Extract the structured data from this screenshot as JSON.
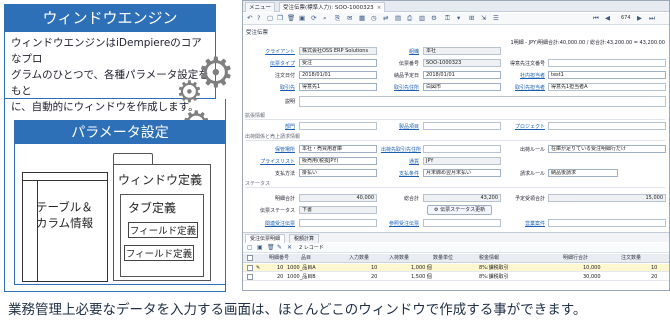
{
  "engine": {
    "title": "ウィンドウエンジン",
    "line1": "ウィンドウエンジンはiDempiereのコアなプロ",
    "line2": "グラムのひとつで、各種パラメータ設定をもと",
    "line3": "に、自動的にウィンドウを作成します。"
  },
  "params": {
    "title": "パラメータ設定",
    "table_line1": "テーブル＆",
    "table_line2": "カラム情報",
    "window_label": "ウィンドウ定義",
    "tab_label": "タブ定義",
    "field1": "フィールド定義",
    "field2": "フィールド定義"
  },
  "app": {
    "menu_tabs": [
      "メニュー",
      "受注伝票(標準入力): SOO-1000323"
    ],
    "record_counter": "674",
    "heading": "受注伝票",
    "summary": "1明細 - JPY)明細合計:40,000.00 / 総合計:43,200.00 = 43,200.00",
    "fields": {
      "client_label": "クライアント",
      "client_value": "株式会社OSS ERP Solutions",
      "org_label": "組織",
      "org_value": "本社",
      "doctype_label": "伝票タイプ",
      "doctype_value": "受注",
      "docno_label": "伝票番号",
      "docno_value": "SOO-1000323",
      "customer_order_label": "得意先注文番号",
      "customer_order_value": "",
      "orderdate_label": "注文日付",
      "orderdate_value": "2018/01/01",
      "promise_label": "納品予定日",
      "promise_value": "2018/01/01",
      "company_agent_label": "社内担当者",
      "company_agent_value": "test1",
      "bp_label": "取引先",
      "bp_value": "得意先1",
      "bp_addr_label": "取引先住所",
      "bp_addr_value": "白図市",
      "bp_contact_label": "取引先担当者",
      "bp_contact_value": "得意先1担当者A",
      "desc_label": "説明",
      "desc_value": ""
    },
    "sections": {
      "extension": "拡張情報",
      "shipping": "出荷関係と売上請求情報",
      "status": "ステータス"
    },
    "extension_fields": {
      "dept_label": "部門",
      "activity_label": "製品項目",
      "project_label": "プロジェクト"
    },
    "shipping_fields": {
      "warehouse_label": "保管場所",
      "warehouse_value": "本社・売買用倉庫",
      "ship_to_label": "出荷先取引先住所",
      "ship_rule_label": "出荷ルール",
      "ship_rule_value": "在庫が足りている受注明細行だけ",
      "pricelist_label": "プライスリスト",
      "pricelist_value": "販売用(税抜JPY)",
      "currency_label": "通貨",
      "currency_value": "JPY",
      "payment_label": "支払方法",
      "payment_value": "掛払い",
      "payterm_label": "支払条件",
      "payterm_value": "月末締め翌月末払い",
      "invoicerule_label": "請求ルール",
      "invoicerule_value": "納品後請求"
    },
    "status_fields": {
      "lines_label": "明細合計",
      "lines_value": "40,000",
      "grand_label": "総合計",
      "grand_value": "43,200",
      "volume_label": "予定受領合計",
      "volume_value": "15,000",
      "docstatus_label": "伝票ステータス",
      "docstatus_value": "下書",
      "docaction_button": "伝票ステータス更新",
      "link_order_label": "関連受注伝票",
      "ref_order_label": "参照受注伝票",
      "sales_label": "営業案件"
    },
    "subtabs": [
      "受注伝票明細",
      "税額計算"
    ],
    "subtoolbar_label": "2 レコード",
    "grid": {
      "headers": [
        "明細番号",
        "品目",
        "入力数量",
        "入荷数量",
        "数量単位",
        "税金情報",
        "明細行合計",
        "注文数量"
      ],
      "rows": [
        [
          "10",
          "1000_品目A",
          "10",
          "1,000 個",
          "8%:課税取引",
          "10,000",
          "10"
        ],
        [
          "20",
          "1000_品目B",
          "20",
          "1,500 個",
          "8%:課税取引",
          "30,000",
          "20"
        ]
      ]
    }
  },
  "caption": "業務管理上必要なデータを入力する画面は、ほとんどこのウィンドウで作成する事ができます。",
  "colors": {
    "accent": "#2e70b7",
    "gear": "#7f7f7f",
    "row_highlight": "#fdf6cf"
  },
  "icons": [
    "gear-icon",
    "toolbar-icons",
    "checkbox"
  ]
}
